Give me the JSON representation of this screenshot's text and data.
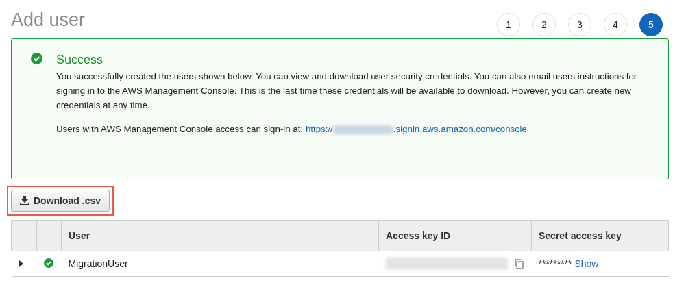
{
  "page": {
    "title": "Add user"
  },
  "steps": [
    {
      "label": "1",
      "selected": false
    },
    {
      "label": "2",
      "selected": false
    },
    {
      "label": "3",
      "selected": false
    },
    {
      "label": "4",
      "selected": false
    },
    {
      "label": "5",
      "selected": true
    }
  ],
  "alert": {
    "title": "Success",
    "message": "You successfully created the users shown below. You can view and download user security credentials. You can also email users instructions for signing in to the AWS Management Console. This is the last time these credentials will be available to download. However, you can create new credentials at any time.",
    "signin_label": "Users with AWS Management Console access can sign-in at:",
    "signin_link_start": "https://",
    "signin_link_end": ".signin.aws.amazon.com/console"
  },
  "download_button": {
    "label": "Download .csv",
    "highlighted": true
  },
  "table": {
    "columns": [
      "User",
      "Access key ID",
      "Secret access key"
    ],
    "rows": [
      {
        "expanded": false,
        "user": "MigrationUser",
        "secret": "*********",
        "show_link": "Show"
      }
    ]
  }
}
